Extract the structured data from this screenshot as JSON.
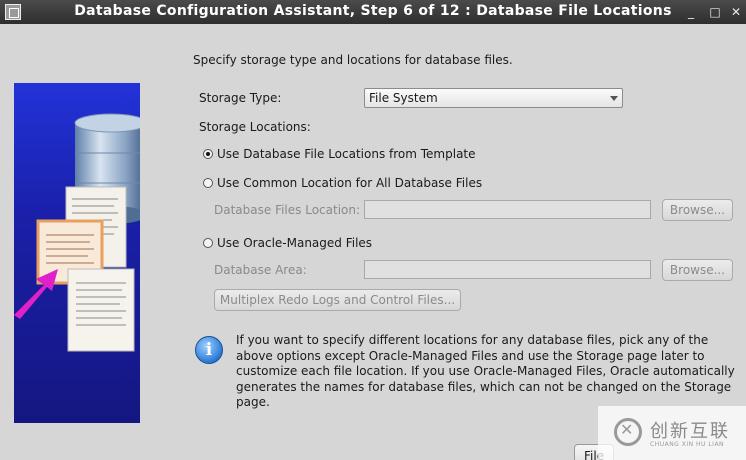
{
  "window": {
    "title": "Database Configuration Assistant, Step 6 of 12 : Database File Locations",
    "minimize_glyph": "_",
    "maximize_glyph": "□",
    "close_glyph": "✕"
  },
  "intro": "Specify storage type and locations for database files.",
  "storage_type": {
    "label": "Storage Type:",
    "value": "File System"
  },
  "storage_locations": {
    "label": "Storage Locations:",
    "options": [
      {
        "label": "Use Database File Locations from Template",
        "selected": true
      },
      {
        "label": "Use Common Location for All Database Files",
        "selected": false
      },
      {
        "label": "Use Oracle-Managed Files",
        "selected": false
      }
    ],
    "db_files_location_label": "Database Files Location:",
    "db_files_location_value": "",
    "db_area_label": "Database Area:",
    "db_area_value": "",
    "browse_label": "Browse...",
    "multiplex_label": "Multiplex Redo Logs and Control Files..."
  },
  "info": {
    "icon_glyph": "i",
    "text": "If you want to specify different locations for any database files, pick any of the above options except Oracle-Managed Files and use the Storage page later to customize each file location. If you use Oracle-Managed Files, Oracle automatically generates the names for database files, which can not be changed on the Storage page."
  },
  "footer": {
    "file_button_label": "File"
  },
  "watermark": {
    "cn": "创新互联",
    "en": "CHUANG XIN HU LIAN"
  }
}
